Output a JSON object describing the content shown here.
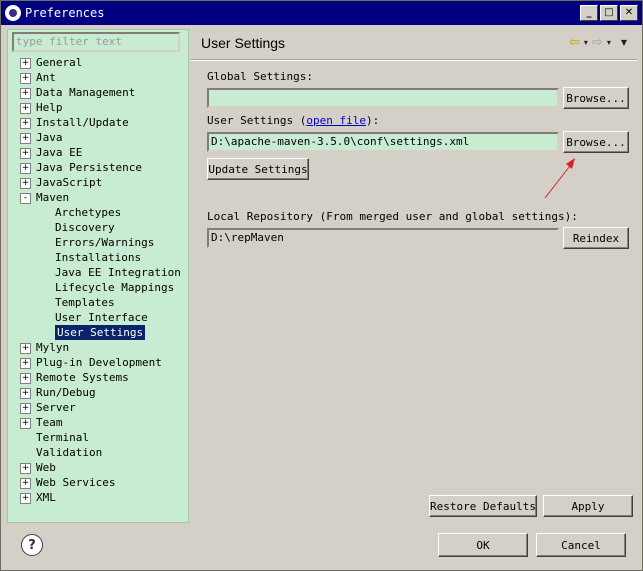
{
  "window": {
    "title": "Preferences",
    "title_buttons": [
      "_",
      "□",
      "✕"
    ]
  },
  "filter": {
    "placeholder": "type filter text"
  },
  "tree": [
    {
      "label": "General",
      "level": 0,
      "expander": "+"
    },
    {
      "label": "Ant",
      "level": 0,
      "expander": "+"
    },
    {
      "label": "Data Management",
      "level": 0,
      "expander": "+"
    },
    {
      "label": "Help",
      "level": 0,
      "expander": "+"
    },
    {
      "label": "Install/Update",
      "level": 0,
      "expander": "+"
    },
    {
      "label": "Java",
      "level": 0,
      "expander": "+"
    },
    {
      "label": "Java EE",
      "level": 0,
      "expander": "+"
    },
    {
      "label": "Java Persistence",
      "level": 0,
      "expander": "+"
    },
    {
      "label": "JavaScript",
      "level": 0,
      "expander": "+"
    },
    {
      "label": "Maven",
      "level": 0,
      "expander": "-"
    },
    {
      "label": "Archetypes",
      "level": 1,
      "expander": ""
    },
    {
      "label": "Discovery",
      "level": 1,
      "expander": ""
    },
    {
      "label": "Errors/Warnings",
      "level": 1,
      "expander": ""
    },
    {
      "label": "Installations",
      "level": 1,
      "expander": ""
    },
    {
      "label": "Java EE Integration",
      "level": 1,
      "expander": ""
    },
    {
      "label": "Lifecycle Mappings",
      "level": 1,
      "expander": ""
    },
    {
      "label": "Templates",
      "level": 1,
      "expander": ""
    },
    {
      "label": "User Interface",
      "level": 1,
      "expander": ""
    },
    {
      "label": "User Settings",
      "level": 1,
      "expander": "",
      "selected": true
    },
    {
      "label": "Mylyn",
      "level": 0,
      "expander": "+"
    },
    {
      "label": "Plug-in Development",
      "level": 0,
      "expander": "+"
    },
    {
      "label": "Remote Systems",
      "level": 0,
      "expander": "+"
    },
    {
      "label": "Run/Debug",
      "level": 0,
      "expander": "+"
    },
    {
      "label": "Server",
      "level": 0,
      "expander": "+"
    },
    {
      "label": "Team",
      "level": 0,
      "expander": "+"
    },
    {
      "label": "Terminal",
      "level": 0,
      "expander": ""
    },
    {
      "label": "Validation",
      "level": 0,
      "expander": ""
    },
    {
      "label": "Web",
      "level": 0,
      "expander": "+"
    },
    {
      "label": "Web Services",
      "level": 0,
      "expander": "+"
    },
    {
      "label": "XML",
      "level": 0,
      "expander": "+"
    }
  ],
  "page": {
    "title": "User Settings",
    "nav": {
      "back": "⇦",
      "forward": "⇨",
      "dropdown": "▾",
      "menu": "▼"
    },
    "global_settings": {
      "label": "Global Settings:",
      "value": "",
      "browse": "Browse..."
    },
    "user_settings": {
      "label": "User Settings (",
      "link": "open file",
      "label_end": "):",
      "value": "D:\\apache-maven-3.5.0\\conf\\settings.xml",
      "browse": "Browse..."
    },
    "update_settings": "Update Settings",
    "local_repo": {
      "label": "Local Repository (From merged user and global settings):",
      "value": "D:\\repMaven",
      "reindex": "Reindex"
    },
    "restore_defaults": "Restore Defaults",
    "apply": "Apply"
  },
  "footer": {
    "help": "?",
    "ok": "OK",
    "cancel": "Cancel"
  },
  "colors": {
    "accent_green": "#c8ecd2",
    "selection": "#0a246a",
    "annotation_arrow": "#e02020",
    "titlebar": "#000080"
  }
}
